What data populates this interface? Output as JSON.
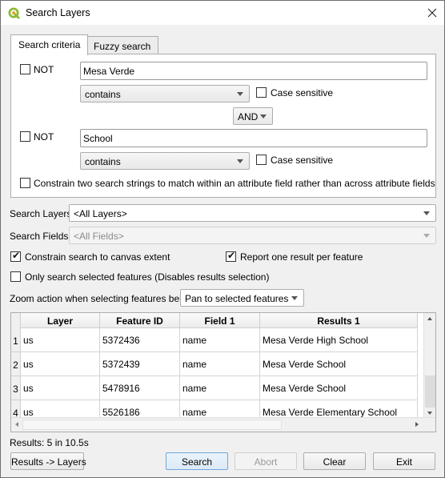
{
  "window": {
    "title": "Search Layers",
    "icon": "qgis-logo-icon",
    "close_icon": "close-icon"
  },
  "tabs": [
    {
      "label": "Search criteria",
      "active": true
    },
    {
      "label": "Fuzzy search",
      "active": false
    }
  ],
  "criteria": {
    "first": {
      "not_label": "NOT",
      "not_checked": false,
      "value": "Mesa Verde",
      "match_mode": "contains",
      "case_sensitive_label": "Case sensitive",
      "case_sensitive": false
    },
    "operator": "AND",
    "second": {
      "not_label": "NOT",
      "not_checked": false,
      "value": "School",
      "match_mode": "contains",
      "case_sensitive_label": "Case sensitive",
      "case_sensitive": false
    },
    "constrain_two_label": "Constrain two search strings to match within an attribute field rather than across attribute fields",
    "constrain_two_checked": false
  },
  "search_layers": {
    "label": "Search Layers",
    "value": "<All Layers>"
  },
  "search_fields": {
    "label": "Search Fields",
    "value": "<All Fields>",
    "disabled": true
  },
  "options": {
    "canvas_extent": {
      "label": "Constrain search to canvas extent",
      "checked": true
    },
    "one_result": {
      "label": "Report one result per feature",
      "checked": true
    },
    "selected_only": {
      "label": "Only search selected features (Disables results selection)",
      "checked": false
    }
  },
  "zoom_action": {
    "label": "Zoom action when selecting features below",
    "value": "Pan to selected features"
  },
  "results_table": {
    "columns": [
      "Layer",
      "Feature ID",
      "Field 1",
      "Results 1"
    ],
    "rows": [
      {
        "num": "1",
        "layer": "us",
        "feature_id": "5372436",
        "field": "name",
        "result": "Mesa Verde High School"
      },
      {
        "num": "2",
        "layer": "us",
        "feature_id": "5372439",
        "field": "name",
        "result": "Mesa Verde School"
      },
      {
        "num": "3",
        "layer": "us",
        "feature_id": "5478916",
        "field": "name",
        "result": "Mesa Verde School"
      },
      {
        "num": "4",
        "layer": "us",
        "feature_id": "5526186",
        "field": "name",
        "result": "Mesa Verde Elementary School"
      }
    ]
  },
  "status": "Results: 5 in 10.5s",
  "buttons": {
    "results_to_layers": "Results -> Layers",
    "search": "Search",
    "abort": "Abort",
    "clear": "Clear",
    "exit": "Exit"
  }
}
